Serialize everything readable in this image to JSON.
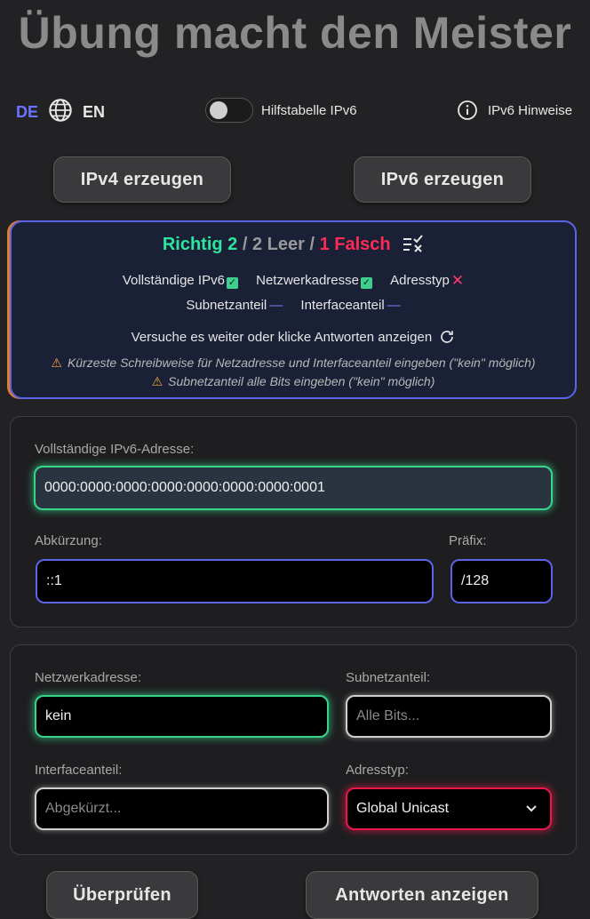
{
  "header": {
    "title": "Übung macht den Meister"
  },
  "topbar": {
    "lang_de": "DE",
    "lang_en": "EN",
    "toggle_label": "Hilfstabelle IPv6",
    "info_label": "IPv6 Hinweise"
  },
  "actions": {
    "ipv4": "IPv4 erzeugen",
    "ipv6": "IPv6 erzeugen"
  },
  "result": {
    "richtig": "Richtig 2",
    "sep1": " / ",
    "leer": "2 Leer",
    "sep2": " / ",
    "falsch": "1 Falsch",
    "checks": {
      "full": "Vollständige IPv6",
      "network": "Netzwerkadresse",
      "type": "Adresstyp",
      "subnet": "Subnetzanteil",
      "interface": "Interfaceanteil"
    },
    "hint": "Versuche es weiter oder klicke Antworten anzeigen",
    "warn1": "Kürzeste Schreibweise für Netzadresse und Interfaceanteil eingeben (\"kein\" möglich)",
    "warn2": "Subnetzanteil alle Bits eingeben (\"kein\" möglich)"
  },
  "address_panel": {
    "full_label": "Vollständige IPv6-Adresse:",
    "full_value": "0000:0000:0000:0000:0000:0000:0000:0001",
    "abbr_label": "Abkürzung:",
    "abbr_value": "::1",
    "prefix_label": "Präfix:",
    "prefix_value": "/128"
  },
  "answer_panel": {
    "network_label": "Netzwerkadresse:",
    "network_value": "kein",
    "subnet_label": "Subnetzanteil:",
    "subnet_placeholder": "Alle Bits...",
    "interface_label": "Interfaceanteil:",
    "interface_placeholder": "Abgekürzt...",
    "type_label": "Adresstyp:",
    "type_value": "Global Unicast"
  },
  "bottom": {
    "check": "Überprüfen",
    "show": "Antworten anzeigen"
  },
  "colors": {
    "accent": "#5b63e6",
    "ok": "#2ee59d",
    "bad": "#ff2a55",
    "warn": "#f0a23a"
  }
}
